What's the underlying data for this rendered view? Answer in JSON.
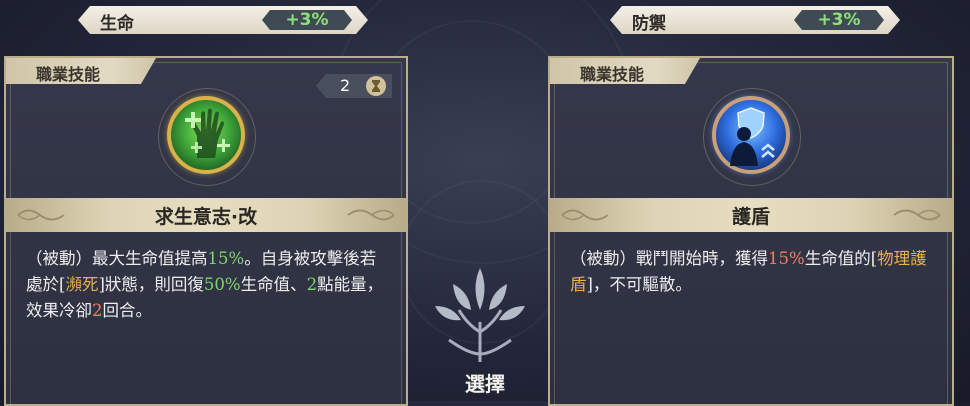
{
  "stats": [
    {
      "label": "生命",
      "value": "+3%"
    },
    {
      "label": "防禦",
      "value": "+3%"
    }
  ],
  "cards": [
    {
      "header": "職業技能",
      "cooldown": "2",
      "icon": "green-hand-heal-icon",
      "name": "求生意志·改",
      "desc": [
        {
          "t": "（被動）最大生命值提高",
          "c": ""
        },
        {
          "t": "15%",
          "c": "hl-green"
        },
        {
          "t": "。自身被攻擊後若處於[",
          "c": ""
        },
        {
          "t": "瀕死",
          "c": "hl-gold"
        },
        {
          "t": "]狀態，則回復",
          "c": ""
        },
        {
          "t": "50%",
          "c": "hl-green"
        },
        {
          "t": "生命值、",
          "c": ""
        },
        {
          "t": "2",
          "c": "hl-green"
        },
        {
          "t": "點能量，效果冷卻",
          "c": ""
        },
        {
          "t": "2",
          "c": "hl-red"
        },
        {
          "t": "回合。",
          "c": ""
        }
      ]
    },
    {
      "header": "職業技能",
      "icon": "blue-shield-person-icon",
      "name": "護盾",
      "desc": [
        {
          "t": "（被動）戰鬥開始時，獲得",
          "c": ""
        },
        {
          "t": "15%",
          "c": "hl-red"
        },
        {
          "t": "生命值的[",
          "c": ""
        },
        {
          "t": "物理護盾",
          "c": "hl-gold"
        },
        {
          "t": "]，不可驅散。",
          "c": ""
        }
      ]
    }
  ],
  "select": {
    "label": "選擇"
  }
}
